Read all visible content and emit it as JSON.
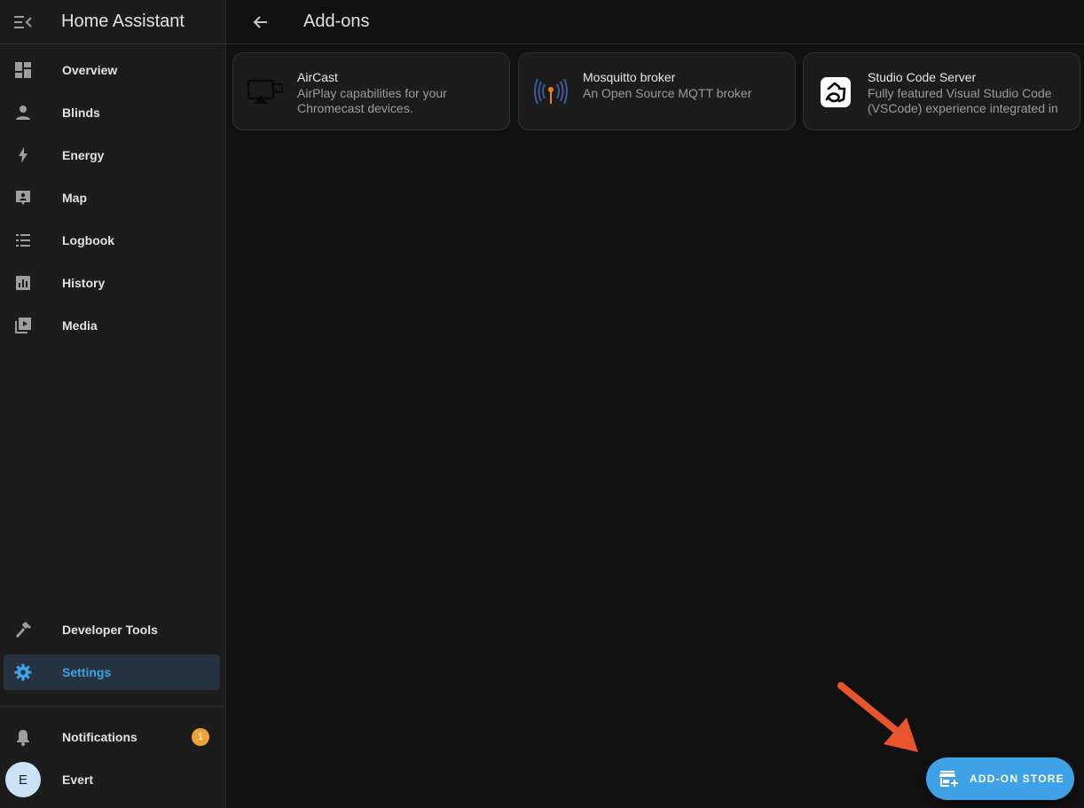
{
  "app": {
    "title": "Home Assistant"
  },
  "sidebar": {
    "items": [
      {
        "label": "Overview",
        "icon": "view-dashboard-icon"
      },
      {
        "label": "Blinds",
        "icon": "account-icon"
      },
      {
        "label": "Energy",
        "icon": "lightning-bolt-icon"
      },
      {
        "label": "Map",
        "icon": "map-marker-icon"
      },
      {
        "label": "Logbook",
        "icon": "format-list-bulleted-icon"
      },
      {
        "label": "History",
        "icon": "chart-box-icon"
      },
      {
        "label": "Media",
        "icon": "play-box-multiple-icon"
      }
    ],
    "bottom_items": [
      {
        "label": "Developer Tools",
        "icon": "hammer-icon"
      },
      {
        "label": "Settings",
        "icon": "cog-icon",
        "active": true
      }
    ],
    "notifications": {
      "label": "Notifications",
      "count": "1"
    },
    "user": {
      "name": "Evert",
      "initial": "E"
    }
  },
  "header": {
    "title": "Add-ons"
  },
  "addons": [
    {
      "name": "AirCast",
      "description": "AirPlay capabilities for your Chromecast devices.",
      "icon": "aircast-icon"
    },
    {
      "name": "Mosquitto broker",
      "description": "An Open Source MQTT broker",
      "icon": "mosquitto-icon"
    },
    {
      "name": "Studio Code Server",
      "description": "Fully featured Visual Studio Code (VSCode) experience integrated in",
      "icon": "studio-code-icon"
    }
  ],
  "fab": {
    "label": "ADD-ON STORE",
    "icon": "store-plus-icon"
  },
  "colors": {
    "accent": "#3fa2e6",
    "badge": "#f0a23b",
    "annotation_arrow": "#e8552c"
  }
}
